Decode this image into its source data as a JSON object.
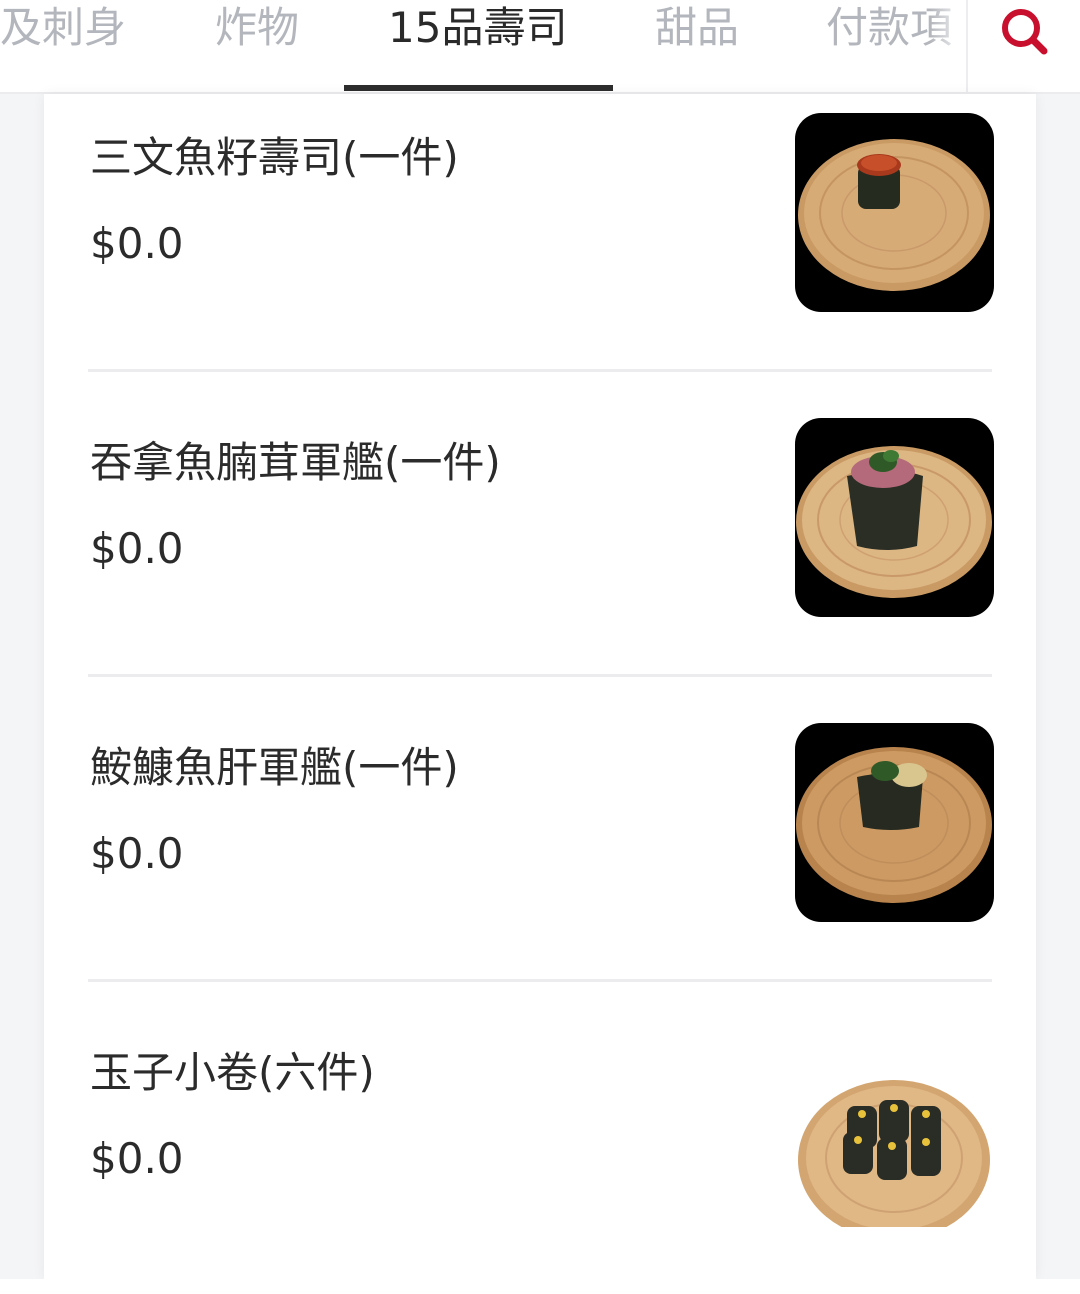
{
  "tabs": [
    {
      "label": "及刺身",
      "active": false
    },
    {
      "label": "炸物",
      "active": false
    },
    {
      "label": "15品壽司",
      "active": true
    },
    {
      "label": "甜品",
      "active": false
    },
    {
      "label": "付款項",
      "active": false
    }
  ],
  "search": {
    "icon": "search-icon",
    "color": "#c8102e"
  },
  "items": [
    {
      "name": "三文魚籽壽司(一件)",
      "price": "$0.0",
      "image": "ikura-gunkan-on-wooden-plate"
    },
    {
      "name": "吞拿魚腩茸軍艦(一件)",
      "price": "$0.0",
      "image": "negitoro-gunkan-on-wooden-plate"
    },
    {
      "name": "鮟鱇魚肝軍艦(一件)",
      "price": "$0.0",
      "image": "ankimo-gunkan-on-wooden-plate"
    },
    {
      "name": "玉子小卷(六件)",
      "price": "$0.0",
      "image": "tamago-maki-on-wooden-plate"
    }
  ],
  "colors": {
    "accent": "#c8102e",
    "active_tab": "#2a2a2a",
    "inactive_tab": "#b3b6bc"
  }
}
